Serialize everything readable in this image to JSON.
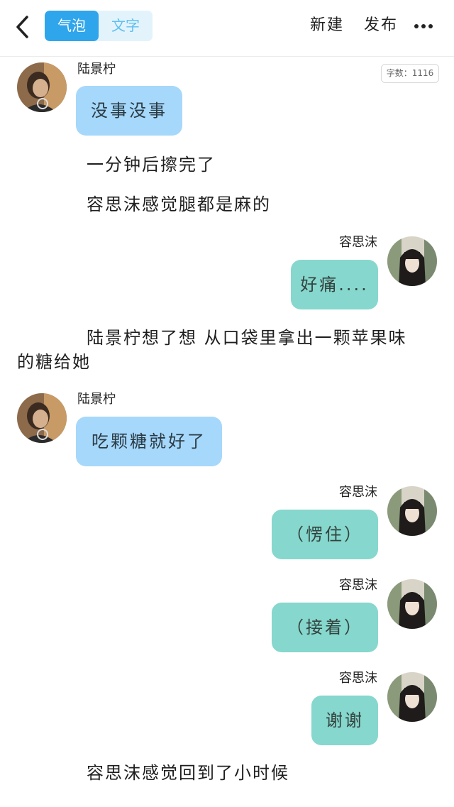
{
  "header": {
    "tab_bubble": "气泡",
    "tab_text": "文字",
    "new_label": "新建",
    "publish_label": "发布"
  },
  "word_count": "字数：1116",
  "messages": [
    {
      "sender": "陆景柠",
      "text": "没事没事"
    },
    {
      "narration": "一分钟后擦完了"
    },
    {
      "narration": "容思沫感觉腿都是麻的"
    },
    {
      "sender": "容思沫",
      "text": "好痛...."
    },
    {
      "narration_line1": "陆景柠想了想 从口袋里拿出一颗苹果味",
      "narration_line2": "的糖给她"
    },
    {
      "sender": "陆景柠",
      "text": "吃颗糖就好了"
    },
    {
      "sender": "容思沫",
      "text": "（愣住）"
    },
    {
      "sender": "容思沫",
      "text": "（接着）"
    },
    {
      "sender": "容思沫",
      "text": "谢谢"
    },
    {
      "narration": "容思沫感觉回到了小时候"
    }
  ],
  "colors": {
    "accent": "#2fa5ec",
    "left_bubble": "#a6d8fb",
    "right_bubble": "#86d7cd"
  },
  "icons": {
    "back": "chevron-left-icon",
    "more": "ellipsis-icon"
  }
}
